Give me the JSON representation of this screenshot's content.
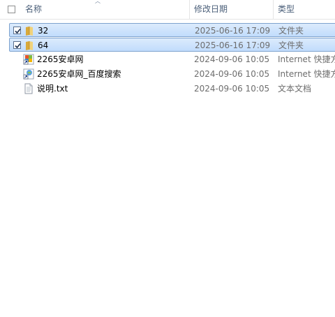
{
  "columns": {
    "name": "名称",
    "date": "修改日期",
    "type": "类型"
  },
  "rows": [
    {
      "name": "32",
      "date": "2025-06-16 17:09",
      "type": "文件夹",
      "icon": "folder-icon",
      "checked": true,
      "selected": true
    },
    {
      "name": "64",
      "date": "2025-06-16 17:09",
      "type": "文件夹",
      "icon": "folder-icon",
      "checked": true,
      "selected": true
    },
    {
      "name": "2265安卓网",
      "date": "2024-09-06 10:05",
      "type": "Internet 快捷方",
      "icon": "internet-shortcut-icon",
      "checked": false,
      "selected": false
    },
    {
      "name": "2265安卓网_百度搜索",
      "date": "2024-09-06 10:05",
      "type": "Internet 快捷方",
      "icon": "internet-shortcut-icon",
      "checked": false,
      "selected": false
    },
    {
      "name": "说明.txt",
      "date": "2024-09-06 10:05",
      "type": "文本文档",
      "icon": "text-document-icon",
      "checked": false,
      "selected": false
    }
  ],
  "colors": {
    "selection_border": "#7da2ce",
    "selection_fill": "#cde3fc",
    "folder": "#e8c25a"
  }
}
